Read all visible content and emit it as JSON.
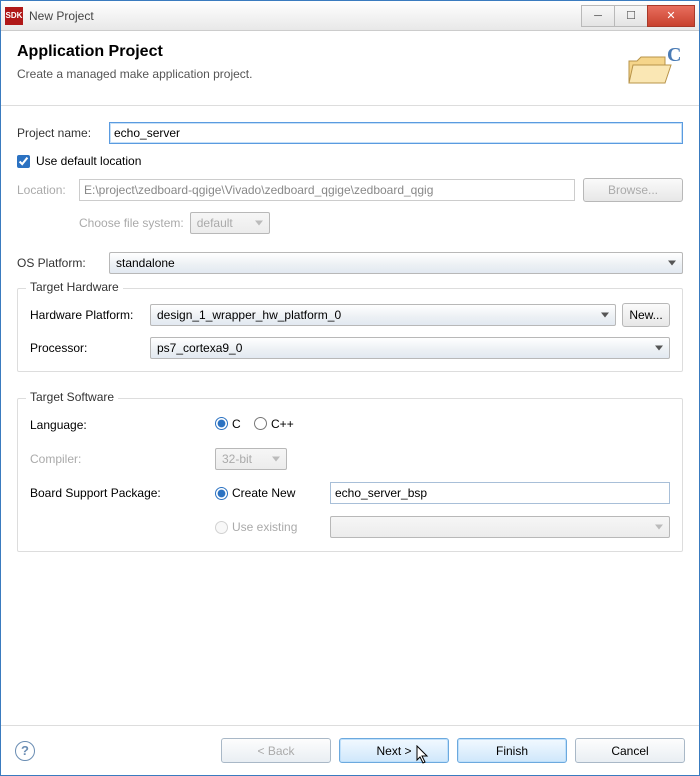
{
  "window": {
    "title": "New Project"
  },
  "header": {
    "title": "Application Project",
    "desc": "Create a managed make application project."
  },
  "project": {
    "name_label": "Project name:",
    "name_value": "echo_server",
    "use_default_label": "Use default location",
    "use_default_checked": true,
    "location_label": "Location:",
    "location_value": "E:\\project\\zedboard-qgige\\Vivado\\zedboard_qgige\\zedboard_qgig",
    "browse_label": "Browse...",
    "filesystem_label": "Choose file system:",
    "filesystem_value": "default"
  },
  "os": {
    "label": "OS Platform:",
    "value": "standalone"
  },
  "hw": {
    "group_label": "Target Hardware",
    "platform_label": "Hardware Platform:",
    "platform_value": "design_1_wrapper_hw_platform_0",
    "new_label": "New...",
    "processor_label": "Processor:",
    "processor_value": "ps7_cortexa9_0"
  },
  "sw": {
    "group_label": "Target Software",
    "language_label": "Language:",
    "lang_c": "C",
    "lang_cpp": "C++",
    "lang_selected": "C",
    "compiler_label": "Compiler:",
    "compiler_value": "32-bit",
    "bsp_label": "Board Support Package:",
    "bsp_create_label": "Create New",
    "bsp_use_label": "Use existing",
    "bsp_selected": "create",
    "bsp_value": "echo_server_bsp"
  },
  "footer": {
    "back": "< Back",
    "next": "Next >",
    "finish": "Finish",
    "cancel": "Cancel"
  }
}
